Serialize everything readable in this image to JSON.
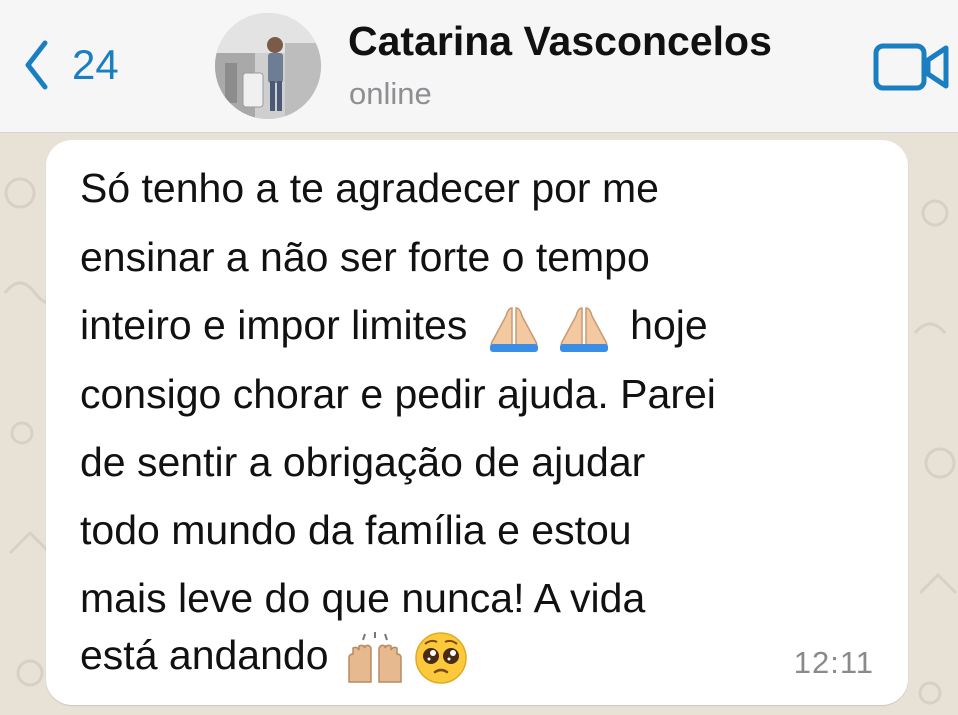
{
  "header": {
    "back_count": "24",
    "contact_name": "Catarina Vasconcelos",
    "contact_status": "online",
    "back_icon": "chevron-left-icon",
    "video_icon": "video-call-icon"
  },
  "message": {
    "lines": [
      "Só tenho a te agradecer por me",
      "ensinar a não ser forte o tempo",
      "inteiro e impor limites",
      "hoje",
      "consigo chorar e pedir ajuda. Parei",
      "de sentir a obrigação de ajudar",
      "todo mundo da família e estou",
      "mais leve do que nunca! A vida",
      "está andando"
    ],
    "emojis": [
      "folded-hands-icon",
      "folded-hands-icon",
      "raising-hands-icon",
      "pleading-face-icon"
    ],
    "time": "12:11"
  },
  "colors": {
    "accent": "#1a7fc1",
    "header_bg": "#f6f6f6",
    "chat_bg": "#e8e1d6",
    "bubble_bg": "#ffffff"
  }
}
